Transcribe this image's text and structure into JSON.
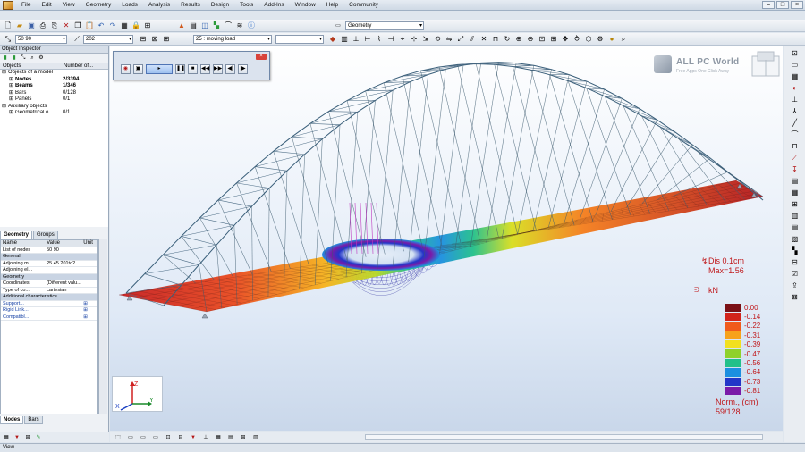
{
  "menu": [
    "File",
    "Edit",
    "View",
    "Geometry",
    "Loads",
    "Analysis",
    "Results",
    "Design",
    "Tools",
    "Add-Ins",
    "Window",
    "Help",
    "Community"
  ],
  "toolbar": {
    "geometry_combo": "Geometry",
    "node_combo": "50 90",
    "bar_combo": "202",
    "load_case_combo": "25 : moving load",
    "load_case_num": "25",
    "load_case_name": "moving load"
  },
  "object_inspector": {
    "title": "Object Inspector",
    "col_objects": "Objects",
    "col_number": "Number of...",
    "tree": [
      {
        "label": "Objects of a model",
        "value": "",
        "indent": 0,
        "bold": false,
        "expander": "⊟"
      },
      {
        "label": "Nodes",
        "value": "2/3394",
        "indent": 1,
        "bold": true,
        "expander": "⊞"
      },
      {
        "label": "Beams",
        "value": "1/346",
        "indent": 1,
        "bold": true,
        "expander": "⊞"
      },
      {
        "label": "Bars",
        "value": "0/128",
        "indent": 1,
        "bold": false,
        "expander": "⊞"
      },
      {
        "label": "Panels",
        "value": "0/1",
        "indent": 1,
        "bold": false,
        "expander": "⊞"
      },
      {
        "label": "Auxiliary objects",
        "value": "",
        "indent": 0,
        "bold": false,
        "expander": "⊟"
      },
      {
        "label": "Geometrical o...",
        "value": "0/1",
        "indent": 1,
        "bold": false,
        "expander": "⊞"
      }
    ],
    "tabs": [
      "Geometry",
      "Groups"
    ],
    "bottom_tabs": [
      "Nodes",
      "Bars"
    ]
  },
  "properties": {
    "headers": {
      "name": "Name",
      "value": "Value",
      "unit": "Unit"
    },
    "rows": [
      {
        "type": "row",
        "name": "List of nodes",
        "value": "50 90",
        "unit": ""
      },
      {
        "type": "section",
        "name": "General",
        "value": "",
        "unit": ""
      },
      {
        "type": "row",
        "name": "Adjoining m...",
        "value": "25 45 201to2...",
        "unit": ""
      },
      {
        "type": "row",
        "name": "Adjoining el...",
        "value": "",
        "unit": ""
      },
      {
        "type": "section",
        "name": "Geometry",
        "value": "",
        "unit": ""
      },
      {
        "type": "row",
        "name": "Coordinates",
        "value": "(Different valu...",
        "unit": ""
      },
      {
        "type": "row",
        "name": "Type of co...",
        "value": "cartesian",
        "unit": ""
      },
      {
        "type": "section",
        "name": "Additional characteristics",
        "value": "",
        "unit": ""
      },
      {
        "type": "link",
        "name": "Support...",
        "value": "",
        "unit": ""
      },
      {
        "type": "link",
        "name": "Rigid Link...",
        "value": "",
        "unit": ""
      },
      {
        "type": "link",
        "name": "Compatibl...",
        "value": "",
        "unit": ""
      }
    ]
  },
  "watermark": {
    "title": "ALL PC World",
    "subtitle": "Free Apps One Click Away"
  },
  "results": {
    "dis_label": "Dis  0.1cm",
    "max_label": "Max=1.56",
    "unit_label": "kN",
    "norm_label": "Norm., (cm)",
    "count_label": "59/128",
    "scale": [
      {
        "value": "0.00",
        "color": "#7a1016"
      },
      {
        "value": "-0.14",
        "color": "#d2231b"
      },
      {
        "value": "-0.22",
        "color": "#f05a1c"
      },
      {
        "value": "-0.31",
        "color": "#f7a21b"
      },
      {
        "value": "-0.39",
        "color": "#f2e01f"
      },
      {
        "value": "-0.47",
        "color": "#8fd12b"
      },
      {
        "value": "-0.56",
        "color": "#22c08a"
      },
      {
        "value": "-0.64",
        "color": "#1c8fe0"
      },
      {
        "value": "-0.73",
        "color": "#2236c8"
      },
      {
        "value": "-0.81",
        "color": "#7a1aa8"
      }
    ]
  },
  "axes": {
    "x": "X",
    "y": "Y",
    "z": "Z"
  },
  "status": "View"
}
